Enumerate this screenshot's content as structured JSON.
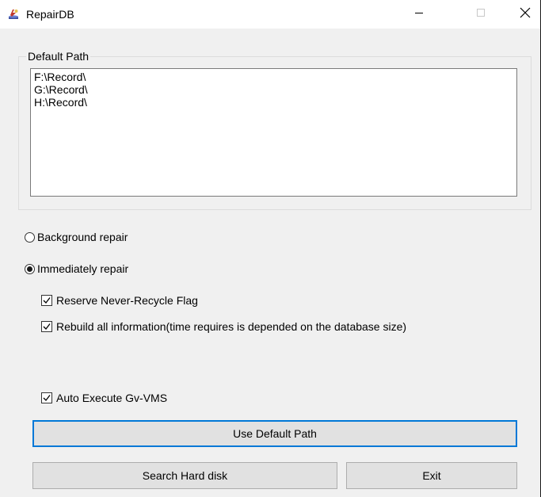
{
  "window": {
    "title": "RepairDB",
    "app_icon": "repair-db-icon",
    "controls": {
      "minimize": "minimize-icon",
      "maximize": "maximize-icon",
      "close": "close-icon"
    }
  },
  "default_path": {
    "label": "Default Path",
    "paths": [
      "F:\\Record\\",
      "G:\\Record\\",
      "H:\\Record\\"
    ]
  },
  "repair_mode": {
    "background_label": "Background repair",
    "background_selected": false,
    "immediate_label": "Immediately repair",
    "immediate_selected": true
  },
  "options": {
    "reserve_flag_label": "Reserve Never-Recycle Flag",
    "reserve_flag_checked": true,
    "rebuild_label": "Rebuild all information(time requires is depended on the database size)",
    "rebuild_checked": true,
    "auto_execute_label": "Auto Execute Gv-VMS",
    "auto_execute_checked": true
  },
  "buttons": {
    "use_default_path": "Use Default Path",
    "search_hard_disk": "Search Hard disk",
    "exit": "Exit"
  },
  "colors": {
    "window_bg": "#f0f0f0",
    "titlebar_bg": "#ffffff",
    "default_button_border": "#0078d7",
    "button_bg": "#e1e1e1"
  }
}
